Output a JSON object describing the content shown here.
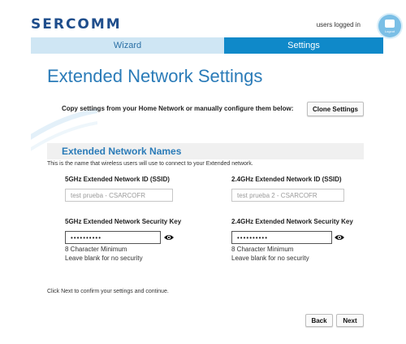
{
  "header": {
    "logo": "SERCOMM",
    "logged_in_text": "users logged in",
    "avatar_caption": "Logout"
  },
  "tabs": [
    {
      "label": "Wizard",
      "active": false
    },
    {
      "label": "Settings",
      "active": true
    }
  ],
  "main": {
    "title": "Extended Network Settings",
    "clone_instructions": "Copy settings from your Home Network or manually configure them below:",
    "clone_button": "Clone Settings"
  },
  "section": {
    "title": "Extended Network Names",
    "description": "This is the name that wireless users will use to connect to your Extended network."
  },
  "ssid5": {
    "label": "5GHz Extended Network ID (SSID)",
    "placeholder": "test prueba - CSARCOFR"
  },
  "ssid24": {
    "label": "2.4GHz Extended Network ID (SSID)",
    "placeholder": "test prueba 2 - CSARCOFR"
  },
  "key5": {
    "label": "5GHz Extended Network Security Key",
    "value": "••••••••••",
    "hint_min": "8 Character Minimum",
    "hint_blank": "Leave blank for no security"
  },
  "key24": {
    "label": "2.4GHz Extended Network Security Key",
    "value": "••••••••••",
    "hint_min": "8 Character Minimum",
    "hint_blank": "Leave blank for no security"
  },
  "footer": {
    "instruction": "Click Next to confirm your settings and continue.",
    "back_button": "Back",
    "next_button": "Next"
  },
  "colors": {
    "accent": "#0f89c9",
    "title_blue": "#2a7bb8",
    "tab_inactive": "#cfe6f4",
    "logo_blue": "#1f4e8c"
  }
}
